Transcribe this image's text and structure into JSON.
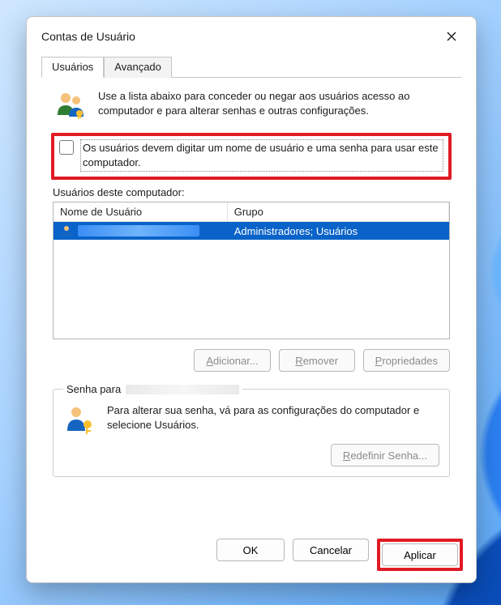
{
  "window": {
    "title": "Contas de Usuário"
  },
  "tabs": {
    "users": "Usuários",
    "advanced": "Avançado"
  },
  "intro_text": "Use a lista abaixo para conceder ou negar aos usuários acesso ao computador e para alterar senhas e outras configurações.",
  "require_login_label": "Os usuários devem digitar um nome de usuário e uma senha para usar este computador.",
  "users_list_label": "Usuários deste computador:",
  "columns": {
    "name": "Nome de Usuário",
    "group": "Grupo"
  },
  "rows": [
    {
      "name_redacted": true,
      "group": "Administradores; Usuários",
      "selected": true
    }
  ],
  "buttons": {
    "add_pre": "A",
    "add_rest": "dicionar...",
    "remove_pre": "R",
    "remove_rest": "emover",
    "props_pre": "P",
    "props_rest": "ropriedades",
    "reset_pre": "R",
    "reset_rest": "edefinir Senha...",
    "ok": "OK",
    "cancel": "Cancelar",
    "apply": "Aplicar"
  },
  "password_group": {
    "legend_prefix": "Senha para ",
    "text": "Para alterar sua senha, vá para as configurações do computador e selecione Usuários."
  },
  "colors": {
    "highlight": "#e01b24",
    "selection": "#0a63c9"
  }
}
